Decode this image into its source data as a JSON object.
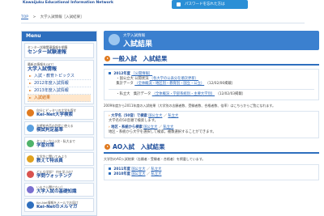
{
  "header": {
    "logo_text": "Kawaijuku Educational Information Network",
    "password_button": "パスワードを忘れた方は"
  },
  "breadcrumb": [
    "TOP",
    "大学入試情報［入試結果］"
  ],
  "breadcrumb_separator": ">",
  "slash": "／",
  "sidebar": {
    "menu_title": "Menu",
    "center": {
      "sub": "センター試験関連情報を網羅",
      "title": "センター試験速報"
    },
    "univ": {
      "sub": "最新の情報をGET！",
      "title": "大学入試情報",
      "items": [
        "入試・教育トピックス",
        "2012年度入試情報",
        "2013年度入試情報",
        "入試結果"
      ]
    },
    "blocks": [
      {
        "sub": "自分にピッタリの大学を探す",
        "title": "Kei-Net大学検索"
      },
      {
        "sub": "志望校合否の判定に使える",
        "title": "模試判定基準"
      },
      {
        "sub": "センターから2次・私大まで",
        "title": "学習対策"
      },
      {
        "sub": "大学生に聞いてみよう",
        "title": "教えて特派員"
      },
      {
        "sub": "どんな学部？ 何を学ぶの？",
        "title": "学問ウォッチング"
      },
      {
        "sub": "いまさら聞けない？",
        "title": "大学入試の基礎知識"
      },
      {
        "sub": "Kei-Net情報をメールでお届け",
        "title": "Kei-Netのメルマガ"
      }
    ]
  },
  "main": {
    "banner_sub": "大学入試情報",
    "banner_title": "入試結果",
    "sec1": {
      "title": "一般入試　入試結果",
      "year": "2012年度",
      "year_link": "［公開情報］",
      "national_label": "・国公立大 公開状況",
      "national_link": "（各大学の公表分を順次更新）",
      "tally_label": "集計データ",
      "tally_link": "（全体概況・地区別・教育別・国立・公立）",
      "tally_date": "（12/02/06掲載）",
      "private_label": "・私立大　集計データ",
      "private_link": "（全体概況・学部系統別・主要大学別）",
      "private_date": "（12/02/03掲載）",
      "note": "2009年度から2011年度の入試結果（大学別の志願者数、受験者数、合格者数、倍率）はこちらからご覧になれます。",
      "search_univ": {
        "label": "大学名（50音）で検索",
        "link1": "国公立大",
        "link2": "私立大",
        "desc": "大学名の50音順で検索します。"
      },
      "search_region": {
        "label": "地区・系統から検索",
        "link1": "国公立大",
        "link2": "私立大",
        "desc": "地区・系統から大学を選択して検索。複数選択することができます。"
      }
    },
    "sec2": {
      "title": "AO入試　入試結果",
      "note": "大学別のAO入試結果（志願者・受験者・合格者）を掲載しています。",
      "rows": [
        {
          "year": "2011年度",
          "link1": "国公立大",
          "link2": "私立大"
        },
        {
          "year": "2010年度",
          "link1": "国公立大",
          "link2": "私立大"
        }
      ]
    }
  }
}
